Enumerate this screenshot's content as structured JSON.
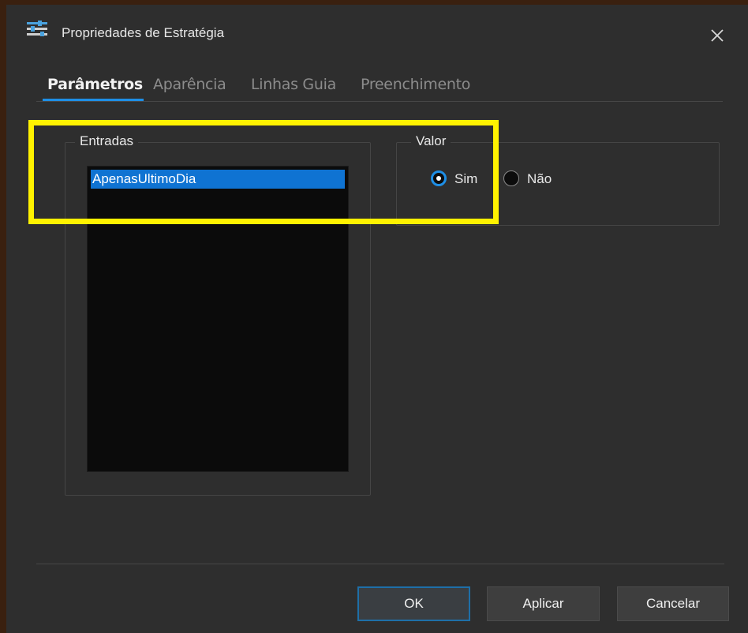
{
  "window": {
    "title": "Propriedades de Estratégia",
    "icon": "sliders-icon",
    "close_icon": "close-icon"
  },
  "tabs": [
    {
      "label": "Parâmetros",
      "active": true
    },
    {
      "label": "Aparência",
      "active": false
    },
    {
      "label": "Linhas Guia",
      "active": false
    },
    {
      "label": "Preenchimento",
      "active": false
    }
  ],
  "inputs_group": {
    "label": "Entradas",
    "items": [
      "ApenasUltimoDia"
    ],
    "selected": "ApenasUltimoDia"
  },
  "value_group": {
    "label": "Valor",
    "options": [
      {
        "label": "Sim",
        "checked": true
      },
      {
        "label": "Não",
        "checked": false
      }
    ]
  },
  "buttons": {
    "ok": "OK",
    "apply": "Aplicar",
    "cancel": "Cancelar"
  },
  "colors": {
    "accent": "#1e8fe6",
    "selection": "#0f73d2",
    "highlight": "#fff200",
    "background": "#2e2e2e"
  }
}
